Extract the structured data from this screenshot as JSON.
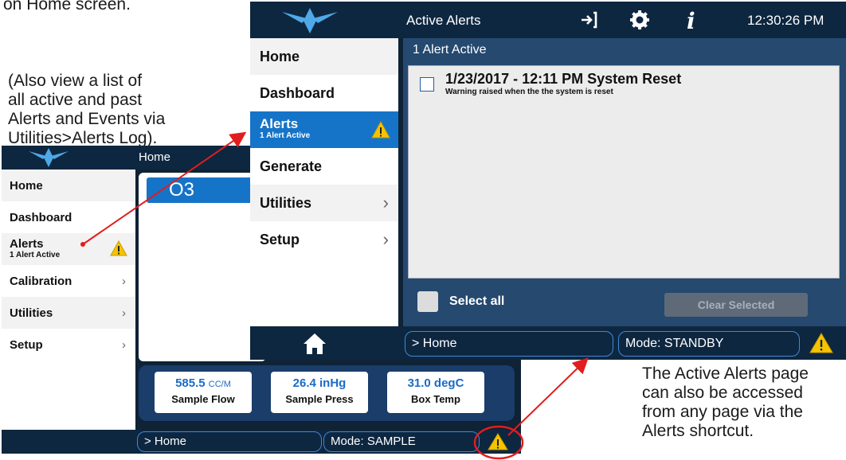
{
  "annotations": {
    "top_partial": "on Home screen.",
    "left_lines": [
      "(Also view a list of",
      "all active and past",
      "Alerts and Events via",
      "Utilities>Alerts Log)."
    ],
    "right_lines": [
      "The Active Alerts page",
      "can also be accessed",
      "from any page via the",
      "Alerts shortcut."
    ]
  },
  "home_screen": {
    "title": "Home",
    "menu": [
      {
        "label": "Home"
      },
      {
        "label": "Dashboard"
      },
      {
        "label": "Alerts",
        "sub": "1 Alert Active"
      },
      {
        "label": "Calibration"
      },
      {
        "label": "Utilities"
      },
      {
        "label": "Setup"
      }
    ],
    "gas_tab": "O3",
    "meters": [
      {
        "value": "585.5",
        "unit": "CC/M",
        "label": "Sample Flow"
      },
      {
        "value": "26.4 inHg",
        "unit": "",
        "label": "Sample Press"
      },
      {
        "value": "31.0 degC",
        "unit": "",
        "label": "Box Temp"
      }
    ],
    "footer": {
      "breadcrumb": "> Home",
      "mode": "Mode: SAMPLE"
    }
  },
  "alerts_screen": {
    "title": "Active Alerts",
    "clock": "12:30:26 PM",
    "menu": [
      {
        "label": "Home"
      },
      {
        "label": "Dashboard"
      },
      {
        "label": "Alerts",
        "sub": "1 Alert Active"
      },
      {
        "label": "Generate"
      },
      {
        "label": "Utilities"
      },
      {
        "label": "Setup"
      }
    ],
    "alerts_count": "1 Alert Active",
    "alerts": [
      {
        "title": "1/23/2017 - 12:11 PM System Reset",
        "description": "Warning raised when the the system is reset"
      }
    ],
    "select_all": "Select all",
    "clear_selected": "Clear Selected",
    "footer": {
      "breadcrumb": "> Home",
      "mode": "Mode: STANDBY"
    }
  },
  "colors": {
    "accent": "#1674c8",
    "header": "#0e2740",
    "warning": "#f5c400",
    "arrow": "#e11d1d"
  },
  "icons": {
    "logout": "sign-in-icon",
    "settings": "gear-icon",
    "info": "info-icon",
    "home": "home-icon",
    "warning": "warning-icon",
    "chevron": "chevron-right-icon"
  }
}
